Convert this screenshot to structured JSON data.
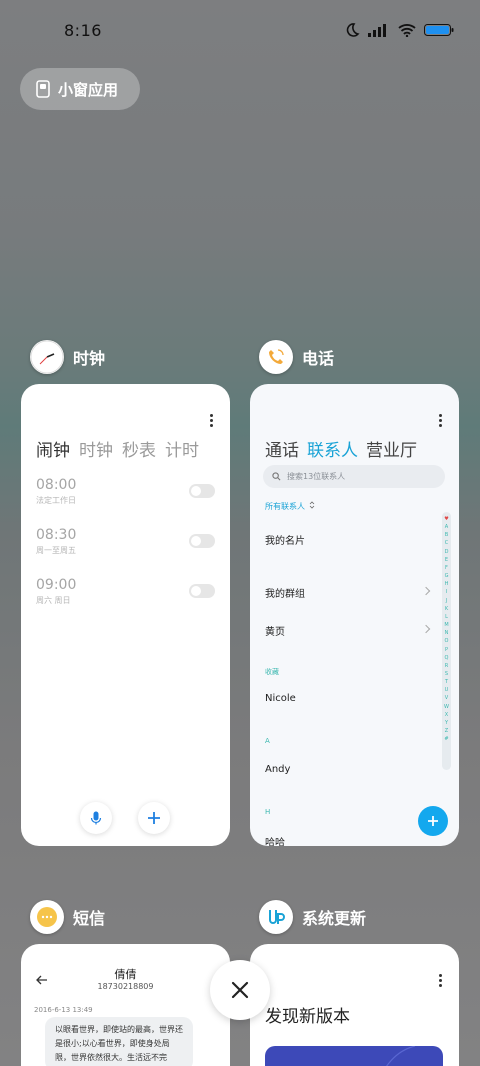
{
  "status_bar": {
    "time": "8:16",
    "icons": [
      "moon-icon",
      "signal-icon",
      "wifi-icon",
      "battery-icon"
    ]
  },
  "mini_window": {
    "label": "小窗应用",
    "icon": "mini-window-icon"
  },
  "clock_app": {
    "name": "时钟",
    "tabs": [
      "闹钟",
      "时钟",
      "秒表",
      "计时"
    ],
    "alarms": [
      {
        "time": "08:00",
        "repeat": "法定工作日"
      },
      {
        "time": "08:30",
        "repeat": "周一至周五"
      },
      {
        "time": "09:00",
        "repeat": "周六 周日"
      }
    ]
  },
  "phone_app": {
    "name": "电话",
    "tabs": [
      "通话",
      "联系人",
      "营业厅"
    ],
    "search_placeholder": "搜索13位联系人",
    "filter": "所有联系人",
    "my_card": "我的名片",
    "groups": "我的群组",
    "yellow_pages": "黄页",
    "sections": [
      {
        "header": "收藏",
        "name": "Nicole"
      },
      {
        "header": "A",
        "name": "Andy"
      },
      {
        "header": "H",
        "name": "哈哈"
      }
    ],
    "alphabet": [
      "♥",
      "A",
      "B",
      "C",
      "D",
      "E",
      "F",
      "G",
      "H",
      "I",
      "J",
      "K",
      "L",
      "M",
      "N",
      "O",
      "P",
      "Q",
      "R",
      "S",
      "T",
      "U",
      "V",
      "W",
      "X",
      "Y",
      "Z",
      "#"
    ]
  },
  "sms_app": {
    "name": "短信",
    "contact": "倩倩",
    "number": "18730218809",
    "date": "2016-6-13 13:49",
    "message": "以眼看世界，即使站的最高，世界还是很小;以心看世界，即使身处局限，世界依然很大。生活远不完"
  },
  "update_app": {
    "name": "系统更新",
    "title": "发现新版本"
  },
  "accent_color": "#1aa3d6"
}
